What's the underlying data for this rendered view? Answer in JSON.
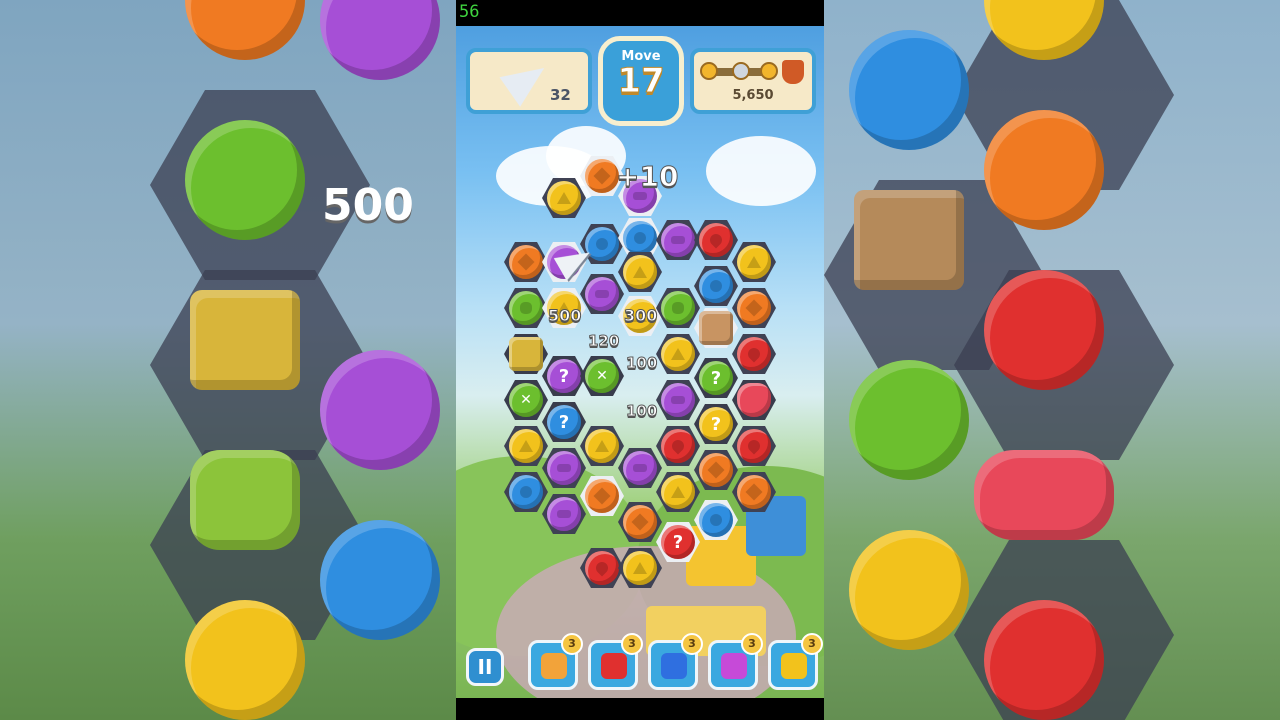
{
  "fps": "56",
  "hud": {
    "planes_count": "32",
    "move_label": "Move",
    "moves_left": "17",
    "score": "5,650"
  },
  "popups": {
    "bonus": "+10",
    "p500": "500",
    "p300": "300",
    "p120": "120",
    "p100a": "100",
    "p100b": "100"
  },
  "background_zoom": {
    "p500": "500"
  },
  "boosters": [
    {
      "name": "scissors-booster",
      "count": "3"
    },
    {
      "name": "boxing-glove-booster",
      "count": "3"
    },
    {
      "name": "spoon-booster",
      "count": "3"
    },
    {
      "name": "ribbon-booster",
      "count": "3"
    },
    {
      "name": "horn-booster",
      "count": "3"
    }
  ],
  "colors": {
    "orange": "#f07a22",
    "yellow": "#f2c21c",
    "purple": "#a64fd6",
    "blue": "#2f8ee0",
    "green": "#6cbf2e",
    "red": "#e0302f",
    "hud_blue": "#3aa0d9"
  },
  "pause_label": "II"
}
